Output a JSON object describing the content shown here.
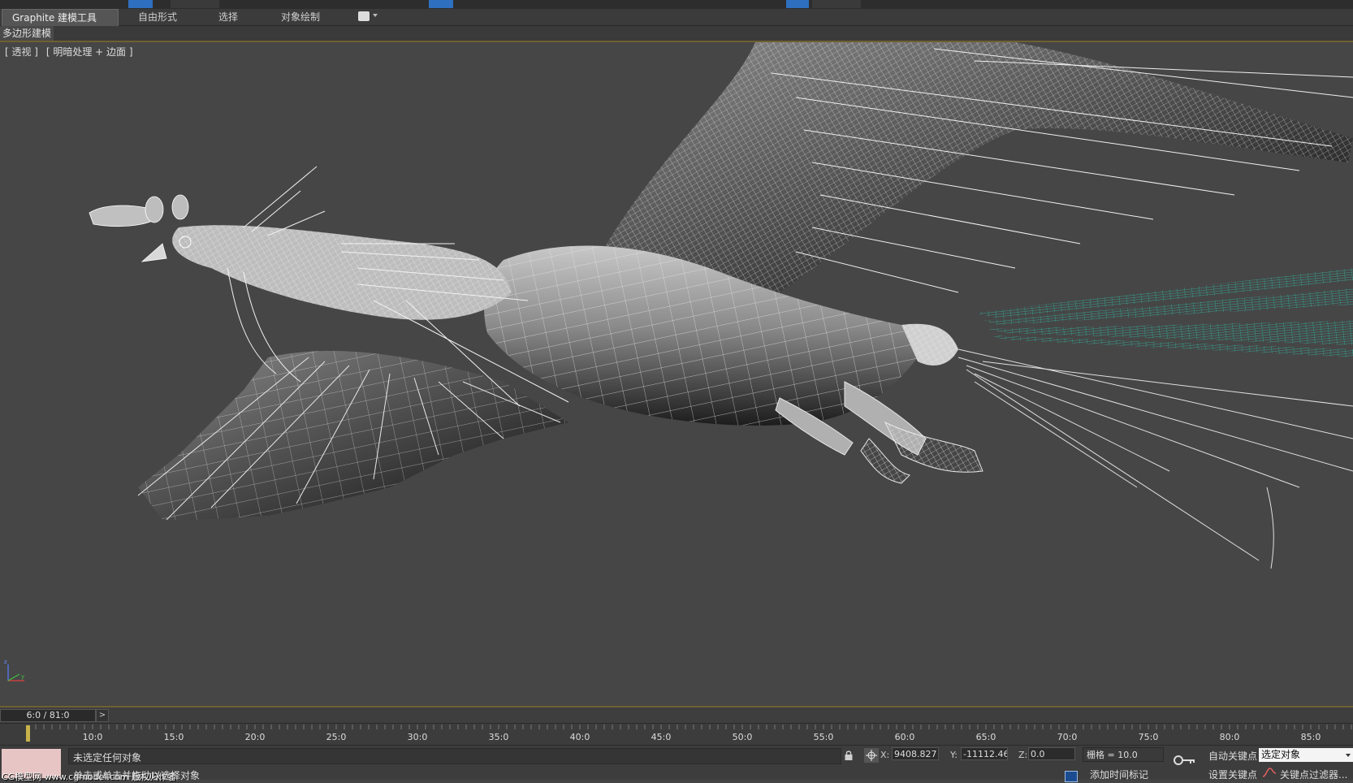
{
  "ribbon": {
    "tabs": [
      {
        "label": "Graphite 建模工具",
        "active": true
      },
      {
        "label": "自由形式"
      },
      {
        "label": "选择"
      },
      {
        "label": "对象绘制"
      }
    ],
    "subtab": "多边形建模"
  },
  "viewport": {
    "label_parts": [
      "[ 透视 ]",
      "[ 明暗处理 + 边面 ]"
    ],
    "selected_color": "#2fb8a0"
  },
  "timeline": {
    "slider": "6:0 / 81:0",
    "next": ">",
    "ticks": [
      "10:0",
      "15:0",
      "20:0",
      "25:0",
      "30:0",
      "35:0",
      "40:0",
      "45:0",
      "50:0",
      "55:0",
      "60:0",
      "65:0",
      "70:0",
      "75:0",
      "80:0",
      "85:0"
    ]
  },
  "status": {
    "selection": "未选定任何对象",
    "prompt": "单击或单击并拖动以选择对象",
    "watermark": "CG模型网 www.cgmodel.com  版权归作者",
    "x_label": "X:",
    "x": "9408.827",
    "y_label": "Y:",
    "y": "-11112.46",
    "z_label": "Z:",
    "z": "0.0",
    "grid": "栅格 = 10.0",
    "add_time_tag": "添加时间标记",
    "auto_key": "自动关键点",
    "set_key": "设置关键点",
    "selection_filter": "选定对象",
    "key_filters": "关键点过滤器..."
  }
}
